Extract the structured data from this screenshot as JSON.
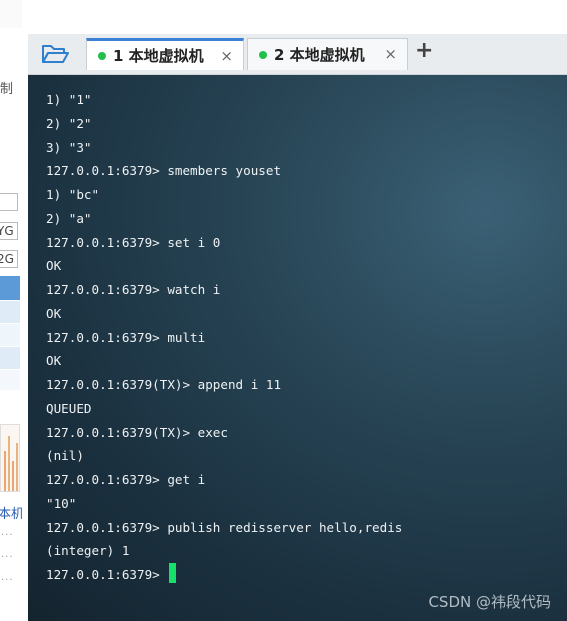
{
  "left_panel": {
    "clip_text": "制",
    "box_texts": [
      "YG",
      "2G"
    ],
    "blue_text": "本机"
  },
  "tabs": [
    {
      "label": "1 本地虚拟机",
      "active": true,
      "status_color": "#21c04a"
    },
    {
      "label": "2 本地虚拟机",
      "active": false,
      "status_color": "#21c04a"
    }
  ],
  "add_tab_label": "+",
  "tab_close_glyph": "×",
  "terminal": {
    "lines": [
      "1) \"1\"",
      "2) \"2\"",
      "3) \"3\"",
      "127.0.0.1:6379> smembers youset",
      "1) \"bc\"",
      "2) \"a\"",
      "127.0.0.1:6379> set i 0",
      "OK",
      "127.0.0.1:6379> watch i",
      "OK",
      "127.0.0.1:6379> multi",
      "OK",
      "127.0.0.1:6379(TX)> append i 11",
      "QUEUED",
      "127.0.0.1:6379(TX)> exec",
      "(nil)",
      "127.0.0.1:6379> get i",
      "\"10\"",
      "127.0.0.1:6379> publish redisserver hello,redis",
      "(integer) 1"
    ],
    "prompt": "127.0.0.1:6379> ",
    "cursor_color": "#16e06a"
  },
  "watermark": "CSDN @祎段代码"
}
